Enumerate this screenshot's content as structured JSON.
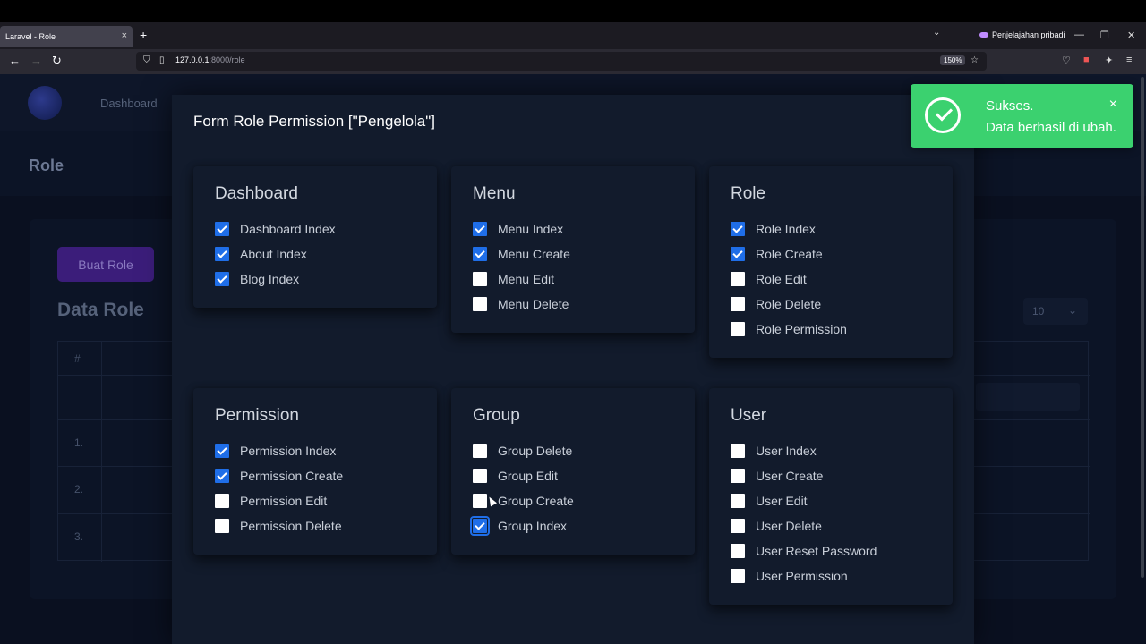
{
  "browser": {
    "tab_title": "Laravel - Role",
    "tab_close": "×",
    "new_tab": "+",
    "private_label": "Penjelajahan pribadi",
    "url_host": "127.0.0.1",
    "url_rest": ":8000/role",
    "zoom": "150%"
  },
  "app": {
    "nav_dashboard": "Dashboard",
    "page_title": "Role",
    "create_button": "Buat Role",
    "data_title": "Data Role",
    "per_page": "10",
    "table": {
      "col_number": "#",
      "rows": [
        "1.",
        "2.",
        "3."
      ]
    }
  },
  "modal": {
    "title": "Form Role Permission [\"Pengelola\"]",
    "groups": [
      {
        "name": "Dashboard",
        "items": [
          {
            "label": "Dashboard Index",
            "checked": true
          },
          {
            "label": "About Index",
            "checked": true
          },
          {
            "label": "Blog Index",
            "checked": true
          }
        ]
      },
      {
        "name": "Menu",
        "items": [
          {
            "label": "Menu Index",
            "checked": true
          },
          {
            "label": "Menu Create",
            "checked": true
          },
          {
            "label": "Menu Edit",
            "checked": false
          },
          {
            "label": "Menu Delete",
            "checked": false
          }
        ]
      },
      {
        "name": "Role",
        "items": [
          {
            "label": "Role Index",
            "checked": true
          },
          {
            "label": "Role Create",
            "checked": true
          },
          {
            "label": "Role Edit",
            "checked": false
          },
          {
            "label": "Role Delete",
            "checked": false
          },
          {
            "label": "Role Permission",
            "checked": false
          }
        ]
      },
      {
        "name": "Permission",
        "items": [
          {
            "label": "Permission Index",
            "checked": true
          },
          {
            "label": "Permission Create",
            "checked": true
          },
          {
            "label": "Permission Edit",
            "checked": false
          },
          {
            "label": "Permission Delete",
            "checked": false
          }
        ]
      },
      {
        "name": "Group",
        "items": [
          {
            "label": "Group Delete",
            "checked": false
          },
          {
            "label": "Group Edit",
            "checked": false
          },
          {
            "label": "Group Create",
            "checked": false
          },
          {
            "label": "Group Index",
            "checked": true,
            "focused": true
          }
        ]
      },
      {
        "name": "User",
        "items": [
          {
            "label": "User Index",
            "checked": false
          },
          {
            "label": "User Create",
            "checked": false
          },
          {
            "label": "User Edit",
            "checked": false
          },
          {
            "label": "User Delete",
            "checked": false
          },
          {
            "label": "User Reset Password",
            "checked": false
          },
          {
            "label": "User Permission",
            "checked": false
          }
        ]
      }
    ]
  },
  "toast": {
    "title": "Sukses.",
    "message": "Data berhasil di ubah.",
    "close": "×",
    "color": "#3bd16f"
  },
  "colors": {
    "accent": "#1f6ee8",
    "background": "#0a1020",
    "modal": "#121b2c"
  }
}
